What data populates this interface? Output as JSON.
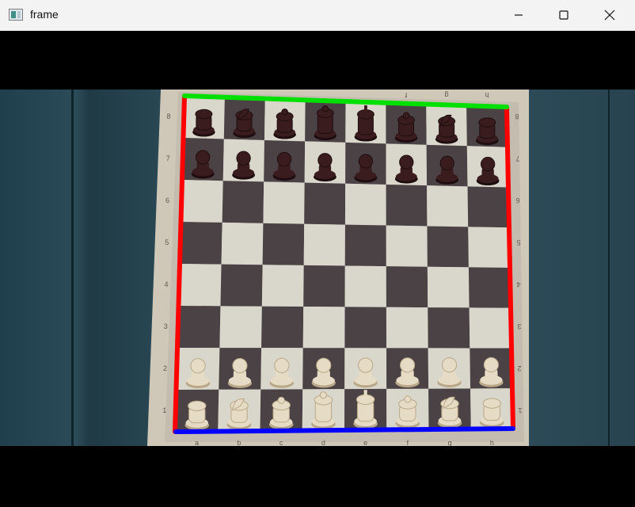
{
  "window": {
    "title": "frame",
    "icon": "app-icon",
    "controls": [
      "minimize-icon",
      "maximize-icon",
      "close-icon"
    ]
  },
  "board": {
    "files": [
      "a",
      "b",
      "c",
      "d",
      "e",
      "f",
      "g",
      "h"
    ],
    "ranks": [
      "8",
      "7",
      "6",
      "5",
      "4",
      "3",
      "2",
      "1"
    ],
    "top_files_partial": [
      "",
      "",
      "",
      "",
      "",
      "f",
      "g",
      "h"
    ],
    "light_color": "#d9d6cc",
    "dark_color": "#4a4245",
    "overlay_colors": {
      "left": "#ff0000",
      "right": "#ff0000",
      "top": "#00e000",
      "bottom": "#0000ff"
    }
  },
  "pieces": {
    "rank8": [
      "rook-dark",
      "knight-dark",
      "bishop-dark",
      "queen-dark",
      "king-dark",
      "bishop-dark",
      "knight-dark",
      "rook-dark"
    ],
    "rank7": [
      "pawn-dark",
      "pawn-dark",
      "pawn-dark",
      "pawn-dark",
      "pawn-dark",
      "pawn-dark",
      "pawn-dark",
      "pawn-dark"
    ],
    "rank2": [
      "pawn-light",
      "pawn-light",
      "pawn-light",
      "pawn-light",
      "pawn-light",
      "pawn-light",
      "pawn-light",
      "pawn-light"
    ],
    "rank1": [
      "rook-light",
      "knight-light",
      "bishop-light",
      "queen-light",
      "king-light",
      "bishop-light",
      "knight-light",
      "rook-light"
    ]
  }
}
